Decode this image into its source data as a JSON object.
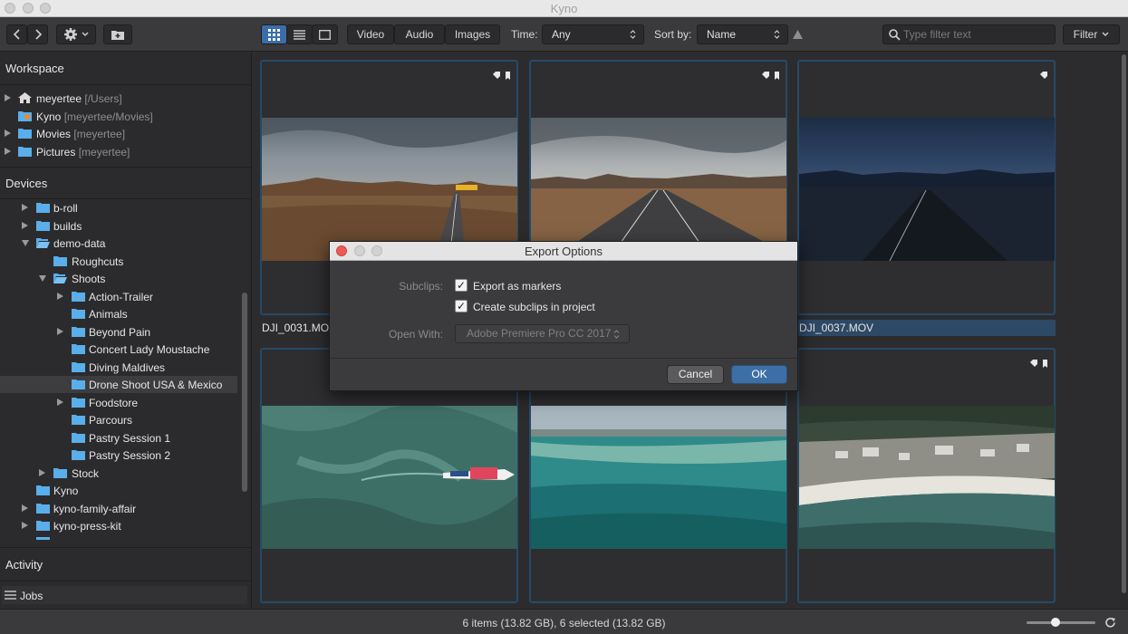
{
  "window": {
    "title": "Kyno"
  },
  "toolbar": {
    "media_filters": [
      "Video",
      "Audio",
      "Images"
    ],
    "time_label": "Time:",
    "time_value": "Any",
    "sort_label": "Sort by:",
    "sort_value": "Name",
    "search_placeholder": "Type filter text",
    "filter_label": "Filter"
  },
  "sidebar": {
    "workspace_header": "Workspace",
    "workspace_items": [
      {
        "label": "meyertee",
        "sub": "[/Users]"
      },
      {
        "label": "Kyno",
        "sub": "[meyertee/Movies]"
      },
      {
        "label": "Movies",
        "sub": "[meyertee]"
      },
      {
        "label": "Pictures",
        "sub": "[meyertee]"
      }
    ],
    "devices_header": "Devices",
    "device_items": [
      "b-roll",
      "builds",
      "demo-data",
      "Roughcuts",
      "Shoots",
      "Action-Trailer",
      "Animals",
      "Beyond Pain",
      "Concert Lady Moustache",
      "Diving Maldives",
      "Drone Shoot USA & Mexico",
      "Foodstore",
      "Parcours",
      "Pastry Session 1",
      "Pastry Session 2",
      "Stock",
      "Kyno",
      "kyno-family-affair",
      "kyno-press-kit"
    ],
    "activity_header": "Activity",
    "jobs_label": "Jobs"
  },
  "grid": {
    "files": [
      {
        "name": "DJI_0031.MOV"
      },
      {
        "name": "DJI_0037.MOV"
      }
    ]
  },
  "dialog": {
    "title": "Export Options",
    "subclips_label": "Subclips:",
    "export_markers": "Export as markers",
    "create_subclips": "Create subclips in project",
    "open_with_label": "Open With:",
    "open_with_value": "Adobe Premiere Pro CC 2017",
    "cancel": "Cancel",
    "ok": "OK"
  },
  "status": {
    "text": "6 items (13.82 GB), 6 selected (13.82 GB)"
  },
  "colors": {
    "accent": "#4a8fd6",
    "folder": "#5aaeea",
    "selection": "#2d4966"
  }
}
